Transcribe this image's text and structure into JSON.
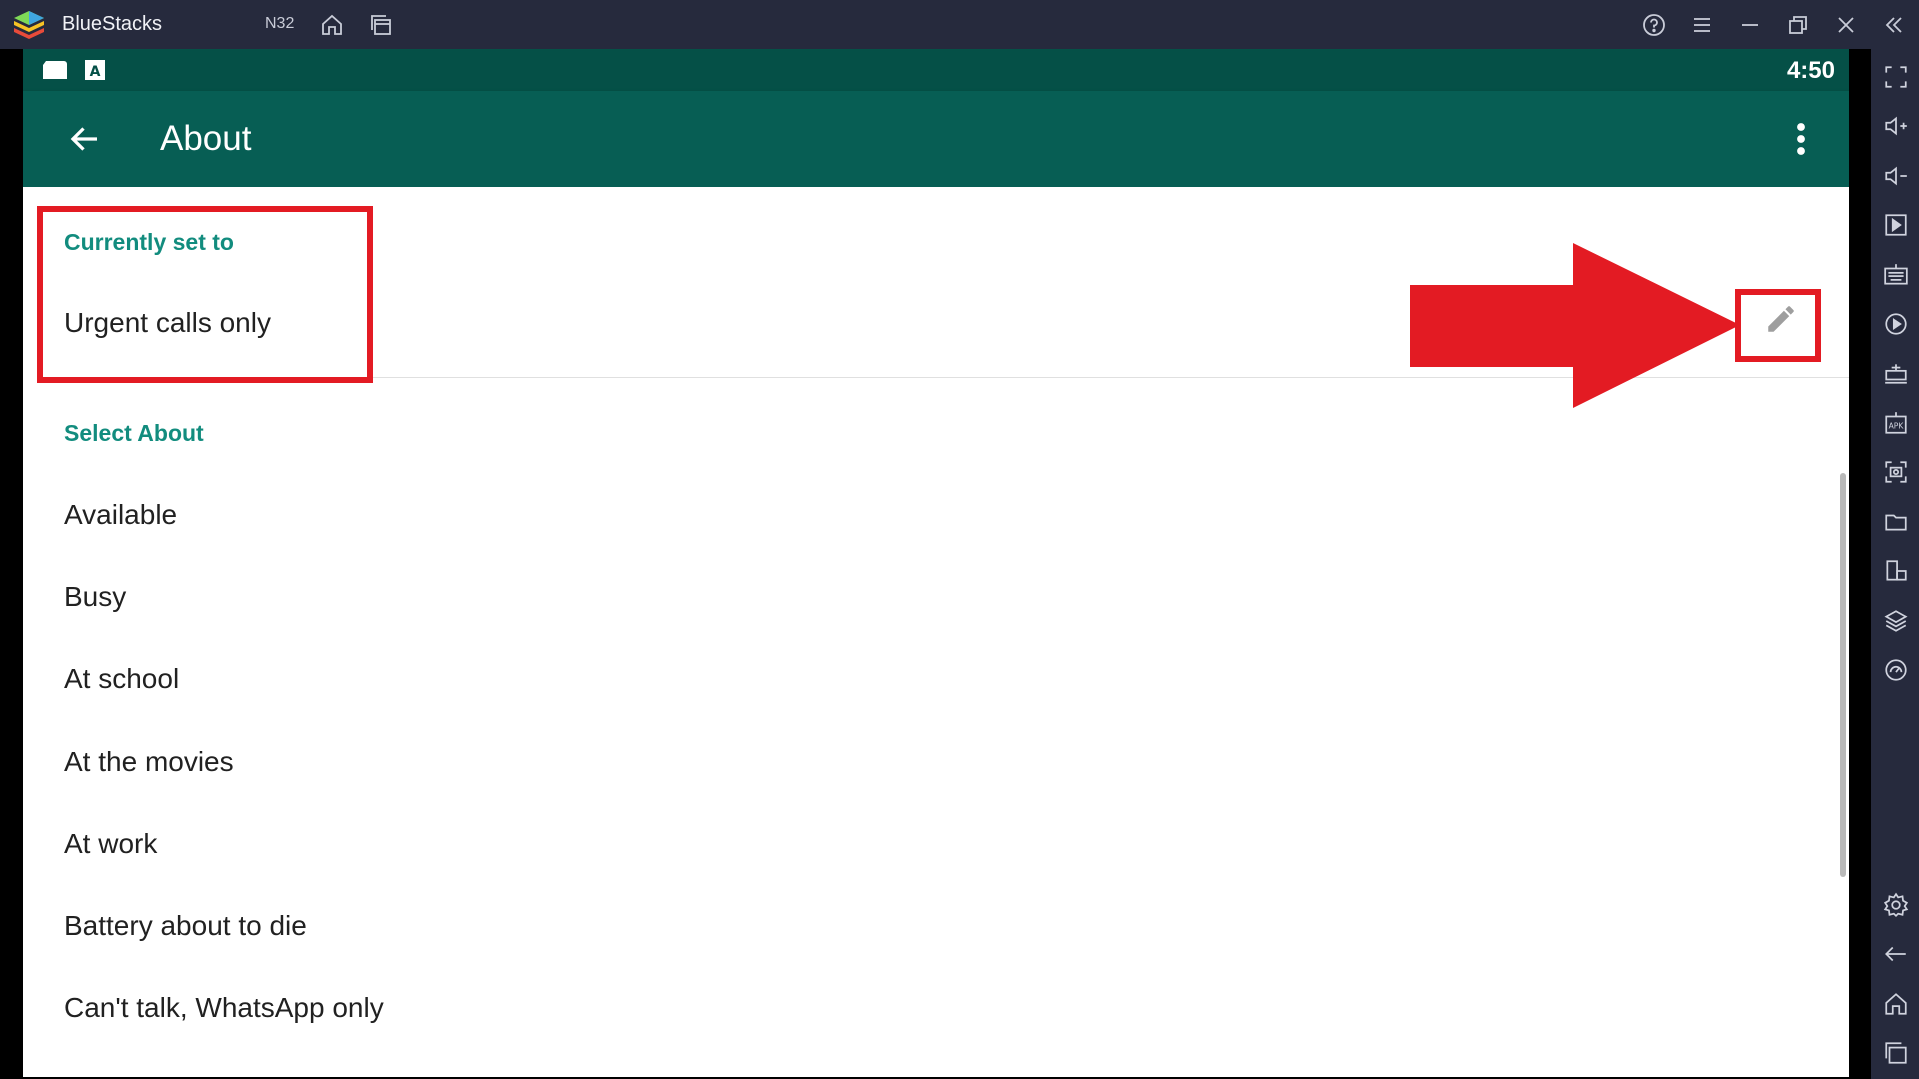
{
  "window": {
    "app_name": "BlueStacks",
    "instance": "N32"
  },
  "statusbar": {
    "time": "4:50"
  },
  "appbar": {
    "title": "About"
  },
  "current": {
    "header": "Currently set to",
    "value": "Urgent calls only"
  },
  "select": {
    "header": "Select About",
    "options": [
      "Available",
      "Busy",
      "At school",
      "At the movies",
      "At work",
      "Battery about to die",
      "Can't talk, WhatsApp only"
    ]
  },
  "colors": {
    "appbar": "#075e54",
    "statusbar": "#055047",
    "accent": "#128c7e",
    "annotation": "#e31b23",
    "chrome": "#262a3d"
  },
  "icons": {
    "titlebar": [
      "home-icon",
      "multi-instance-icon",
      "help-icon",
      "menu-icon",
      "minimize-icon",
      "restore-icon",
      "close-icon",
      "collapse-sidebar-icon"
    ],
    "sidebar": [
      "fullscreen-icon",
      "volume-up-icon",
      "volume-down-icon",
      "media-icon",
      "keyboard-icon",
      "macro-icon",
      "build-icon",
      "apk-icon",
      "screenshot-icon",
      "folder-icon",
      "resize-icon",
      "layers-icon",
      "eco-icon",
      "settings-icon",
      "back-icon",
      "home-icon",
      "recents-icon"
    ]
  }
}
